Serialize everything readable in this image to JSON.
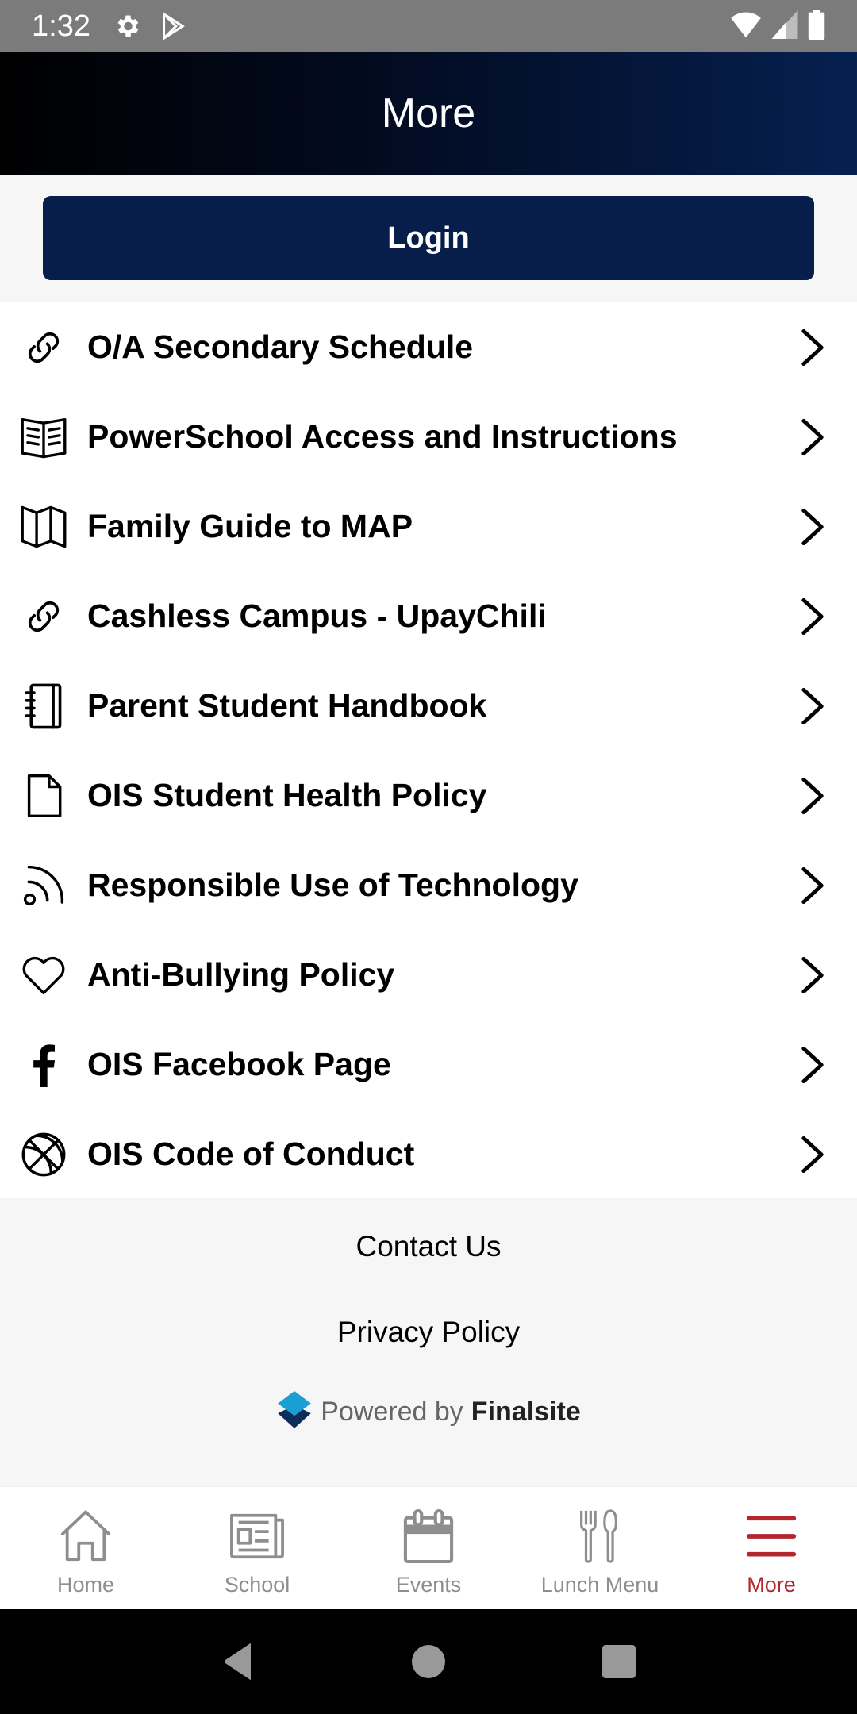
{
  "status_bar": {
    "time": "1:32",
    "icons": [
      "settings-icon",
      "play-store-icon",
      "wifi-icon",
      "signal-icon",
      "battery-icon"
    ]
  },
  "header": {
    "title": "More"
  },
  "login": {
    "label": "Login"
  },
  "menu": {
    "items": [
      {
        "label": "O/A Secondary Schedule",
        "icon": "link-icon"
      },
      {
        "label": "PowerSchool Access and Instructions",
        "icon": "open-book-icon"
      },
      {
        "label": "Family Guide to MAP",
        "icon": "map-icon"
      },
      {
        "label": "Cashless Campus - UpayChili",
        "icon": "link-icon"
      },
      {
        "label": "Parent Student Handbook",
        "icon": "notebook-icon"
      },
      {
        "label": "OIS Student Health Policy",
        "icon": "document-icon"
      },
      {
        "label": "Responsible Use of Technology",
        "icon": "rss-icon"
      },
      {
        "label": "Anti-Bullying Policy",
        "icon": "heart-icon"
      },
      {
        "label": "OIS Facebook Page",
        "icon": "facebook-icon"
      },
      {
        "label": "OIS Code of Conduct",
        "icon": "basketball-icon"
      }
    ]
  },
  "footer": {
    "contact": "Contact Us",
    "privacy": "Privacy Policy",
    "powered_prefix": "Powered by",
    "powered_brand": "Finalsite"
  },
  "bottom_nav": {
    "items": [
      {
        "label": "Home",
        "icon": "home-icon",
        "active": false
      },
      {
        "label": "School",
        "icon": "newspaper-icon",
        "active": false
      },
      {
        "label": "Events",
        "icon": "calendar-icon",
        "active": false
      },
      {
        "label": "Lunch Menu",
        "icon": "utensils-icon",
        "active": false
      },
      {
        "label": "More",
        "icon": "hamburger-menu-icon",
        "active": true
      }
    ]
  },
  "colors": {
    "header_dark": "#000000",
    "header_navy": "#06204f",
    "login_button": "#061e49",
    "active_tab": "#b3262d",
    "inactive_tab": "#8e8e8e",
    "finalsite_light_blue": "#1a9fd4",
    "finalsite_dark_blue": "#0d2d5a"
  }
}
